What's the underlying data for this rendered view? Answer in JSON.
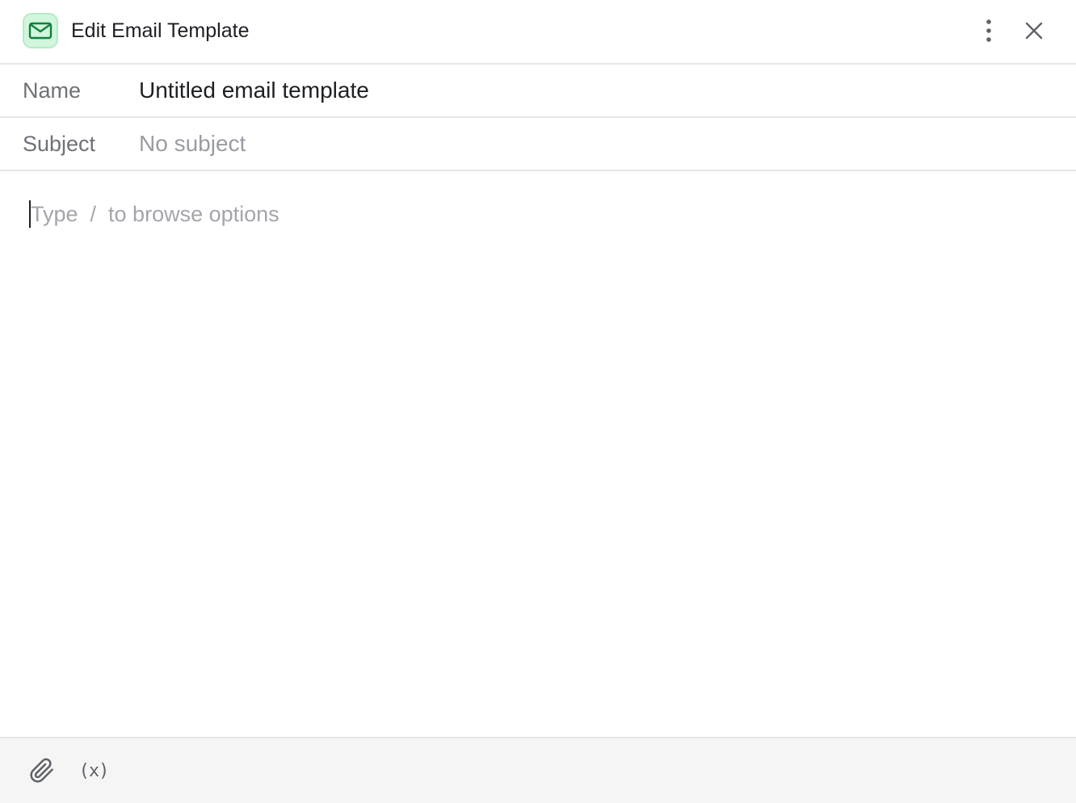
{
  "header": {
    "icon": "mail-icon",
    "title": "Edit Email Template",
    "more_icon": "more-vertical-icon",
    "close_icon": "close-icon"
  },
  "fields": {
    "name": {
      "label": "Name",
      "value": "Untitled email template"
    },
    "subject": {
      "label": "Subject",
      "value": "",
      "placeholder": "No subject"
    }
  },
  "editor": {
    "placeholder": "Type  /  to browse options"
  },
  "footer": {
    "attach_icon": "paperclip-icon",
    "variable_icon": "variable-icon",
    "variable_glyph": "(x)"
  },
  "colors": {
    "accent": "#12803c",
    "icon_bg": "#d2f5dd",
    "footer_bg": "#f5f5f5",
    "border": "#e6e6e8"
  }
}
